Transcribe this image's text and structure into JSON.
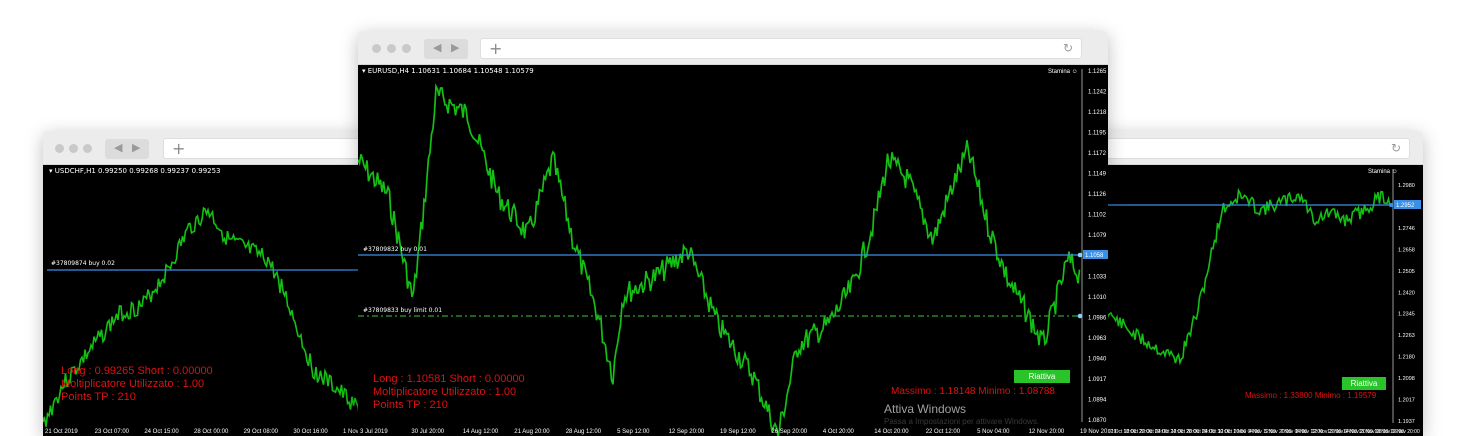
{
  "windows": {
    "left": {
      "symbol": "USDCHF,H1  0.99250 0.99268 0.99237 0.99253",
      "order_label": "#37809874 buy 0.02",
      "info_lines": [
        "Long : 0.99265 Short : 0.00000",
        "Moltiplicatore Utilizzato : 1.00",
        "Points TP : 210"
      ],
      "time_labels": [
        "21 Oct 2019",
        "23 Oct 07:00",
        "24 Oct 15:00",
        "28 Oct 00:00",
        "29 Oct 08:00",
        "30 Oct 16:00",
        "1 Nov 00:00"
      ]
    },
    "center": {
      "symbol": "EURUSD,H4  1.10631 1.10684 1.10548 1.10579",
      "stamina": "Stamina ☺",
      "order_buy": "#37809832 buy 0.01",
      "order_limit": "#37809833 buy limit 0.01",
      "info_lines": [
        "Long : 1.10581 Short : 0.00000",
        "Moltiplicatore Utilizzato : 1.00",
        "Points TP : 210"
      ],
      "riattiva": "Riattiva",
      "maxmin": "Massimo : 1.18148 Minimo : 1.08788",
      "attiva_windows": "Attiva Windows",
      "attiva_sub": "Passa a Impostazioni per attivare Windows.",
      "current_price": "1.1058",
      "price_labels": [
        "1.1265",
        "1.1242",
        "1.1218",
        "1.1195",
        "1.1172",
        "1.1149",
        "1.1126",
        "1.1102",
        "1.1079",
        "1.1056",
        "1.1033",
        "1.1010",
        "1.0986",
        "1.0963",
        "1.0940",
        "1.0917",
        "1.0894",
        "1.0870"
      ],
      "time_labels": [
        "3 Jul 2019",
        "30 Jul 20:00",
        "14 Aug 12:00",
        "21 Aug 20:00",
        "28 Aug 12:00",
        "5 Sep 12:00",
        "12 Sep 20:00",
        "19 Sep 12:00",
        "26 Sep 20:00",
        "4 Oct 20:00",
        "14 Oct 20:00",
        "22 Oct 12:00",
        "5 Nov 04:00",
        "12 Nov 20:00",
        "19 Nov 20:00"
      ]
    },
    "right": {
      "stamina": "Stamina ☺",
      "riattiva": "Riattiva",
      "maxmin": "Massimo : 1.33800 Minimo : 1.19579",
      "current_price": "1.2952",
      "price_labels": [
        "1.2980",
        "1.2828",
        "1.2746",
        "1.2658",
        "1.2505",
        "1.2420",
        "1.2345",
        "1.2263",
        "1.2180",
        "1.2098",
        "1.2017",
        "1.1937"
      ],
      "time_labels": [
        "1 Oct 2019",
        "17 Oct 12:00",
        "18 Oct 20:00",
        "22 Oct 04:00",
        "23 Oct 12:00",
        "24 Oct 20:00",
        "28 Oct 04:00",
        "29 Oct 12:00",
        "30 Oct 20:00",
        "1 Nov 04:00",
        "4 Nov 12:00",
        "5 Nov 20:00",
        "7 Nov 04:00",
        "8 Nov 12:00",
        "12 Nov 20:00",
        "13 Nov 04:00",
        "14 Nov 20:00",
        "15 Nov 08:00",
        "18 Nov 16:00",
        "19 Nov 20:00"
      ]
    }
  },
  "colors": {
    "candle": "#13c013",
    "order_line": "#3a8fe6",
    "limit_line": "#2e9e2e",
    "info_text": "#e01010",
    "button": "#29c429"
  }
}
